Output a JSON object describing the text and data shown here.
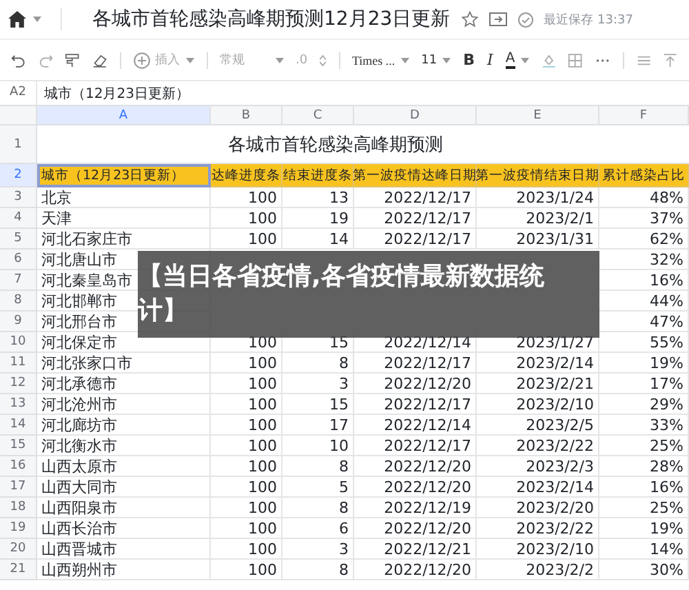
{
  "document": {
    "title": "各城市首轮感染高峰期预测12月23日更新",
    "save_status": "最近保存 13:37"
  },
  "toolbar": {
    "insert": "插入",
    "number_format": "常规",
    "decimal": ".0",
    "font": "Times ...",
    "font_size": "11",
    "bold": "B",
    "italic": "I",
    "text_color": "A"
  },
  "formula_bar": {
    "cell": "A2",
    "value": "城市（12月23日更新）"
  },
  "columns": [
    {
      "label": "A",
      "selected": true
    },
    {
      "label": "B",
      "selected": false
    },
    {
      "label": "C",
      "selected": false
    },
    {
      "label": "D",
      "selected": false
    },
    {
      "label": "E",
      "selected": false
    },
    {
      "label": "F",
      "selected": false
    }
  ],
  "rows": [
    {
      "number": "1",
      "selected": false,
      "kind": "title",
      "title": "各城市首轮感染高峰期预测"
    },
    {
      "number": "2",
      "selected": true,
      "kind": "header",
      "cells": [
        "城市（12月23日更新）",
        "达峰进度条",
        "结束进度条",
        "第一波疫情达峰日期",
        "第一波疫情结束日期",
        "累计感染占比"
      ]
    },
    {
      "number": "3",
      "selected": false,
      "kind": "data",
      "cells": [
        "北京",
        "100",
        "13",
        "2022/12/17",
        "2023/1/24",
        "48%"
      ]
    },
    {
      "number": "4",
      "selected": false,
      "kind": "data",
      "cells": [
        "天津",
        "100",
        "19",
        "2022/12/17",
        "2023/2/1",
        "37%"
      ]
    },
    {
      "number": "5",
      "selected": false,
      "kind": "data",
      "cells": [
        "河北石家庄市",
        "100",
        "14",
        "2022/12/17",
        "2023/1/31",
        "62%"
      ]
    },
    {
      "number": "6",
      "selected": false,
      "kind": "data",
      "cells": [
        "河北唐山市",
        null,
        null,
        null,
        null,
        "32%"
      ]
    },
    {
      "number": "7",
      "selected": false,
      "kind": "data",
      "cells": [
        "河北秦皇岛市",
        null,
        null,
        null,
        null,
        "16%"
      ]
    },
    {
      "number": "8",
      "selected": false,
      "kind": "data",
      "cells": [
        "河北邯郸市",
        null,
        null,
        null,
        null,
        "44%"
      ]
    },
    {
      "number": "9",
      "selected": false,
      "kind": "data",
      "cells": [
        "河北邢台市",
        null,
        null,
        null,
        null,
        "47%"
      ]
    },
    {
      "number": "10",
      "selected": false,
      "kind": "data",
      "cells": [
        "河北保定市",
        "100",
        "15",
        "2022/12/14",
        "2023/1/27",
        "55%"
      ]
    },
    {
      "number": "11",
      "selected": false,
      "kind": "data",
      "cells": [
        "河北张家口市",
        "100",
        "8",
        "2022/12/17",
        "2023/2/14",
        "19%"
      ]
    },
    {
      "number": "12",
      "selected": false,
      "kind": "data",
      "cells": [
        "河北承德市",
        "100",
        "3",
        "2022/12/20",
        "2023/2/21",
        "17%"
      ]
    },
    {
      "number": "13",
      "selected": false,
      "kind": "data",
      "cells": [
        "河北沧州市",
        "100",
        "15",
        "2022/12/17",
        "2023/2/10",
        "29%"
      ]
    },
    {
      "number": "14",
      "selected": false,
      "kind": "data",
      "cells": [
        "河北廊坊市",
        "100",
        "17",
        "2022/12/14",
        "2023/2/5",
        "33%"
      ]
    },
    {
      "number": "15",
      "selected": false,
      "kind": "data",
      "cells": [
        "河北衡水市",
        "100",
        "10",
        "2022/12/17",
        "2023/2/22",
        "25%"
      ]
    },
    {
      "number": "16",
      "selected": false,
      "kind": "data",
      "cells": [
        "山西太原市",
        "100",
        "8",
        "2022/12/20",
        "2023/2/3",
        "28%"
      ]
    },
    {
      "number": "17",
      "selected": false,
      "kind": "data",
      "cells": [
        "山西大同市",
        "100",
        "5",
        "2022/12/20",
        "2023/2/14",
        "16%"
      ]
    },
    {
      "number": "18",
      "selected": false,
      "kind": "data",
      "cells": [
        "山西阳泉市",
        "100",
        "8",
        "2022/12/19",
        "2023/2/20",
        "25%"
      ]
    },
    {
      "number": "19",
      "selected": false,
      "kind": "data",
      "cells": [
        "山西长治市",
        "100",
        "6",
        "2022/12/20",
        "2023/2/22",
        "19%"
      ]
    },
    {
      "number": "20",
      "selected": false,
      "kind": "data",
      "cells": [
        "山西晋城市",
        "100",
        "3",
        "2022/12/21",
        "2023/2/10",
        "14%"
      ]
    },
    {
      "number": "21",
      "selected": false,
      "kind": "data",
      "cells": [
        "山西朔州市",
        "100",
        "8",
        "2022/12/20",
        "2023/2/2",
        "30%"
      ]
    }
  ],
  "banner": {
    "text": "【当日各省疫情,各省疫情最新数据统计】"
  }
}
